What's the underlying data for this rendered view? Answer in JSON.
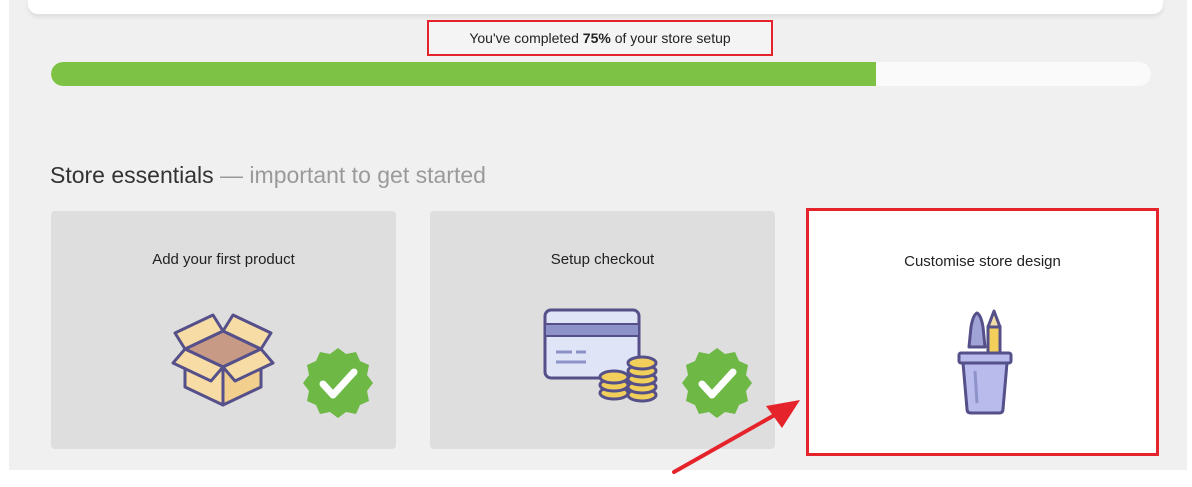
{
  "progress": {
    "text_before": "You've completed",
    "percent_label": "75%",
    "text_after": "of your store setup",
    "fraction": 0.75,
    "fill_color": "#7dc244"
  },
  "section": {
    "title": "Store essentials",
    "subtitle": "— important to get started"
  },
  "cards": [
    {
      "title": "Add your first product",
      "icon": "box-icon",
      "completed": true
    },
    {
      "title": "Setup checkout",
      "icon": "credit-card-coins-icon",
      "completed": true
    },
    {
      "title": "Customise store design",
      "icon": "brush-pencil-cup-icon",
      "completed": false,
      "highlighted": true
    }
  ],
  "annotation": {
    "color": "#e5232b"
  }
}
